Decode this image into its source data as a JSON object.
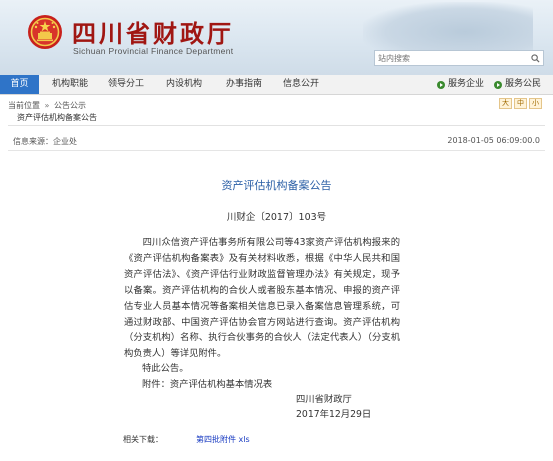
{
  "header": {
    "title": "四川省财政厅",
    "subtitle": "Sichuan Provincial Finance Department",
    "emblem_icon": "national-emblem-icon"
  },
  "search": {
    "placeholder": "站内搜索",
    "icon": "search-icon"
  },
  "nav": {
    "items": [
      {
        "label": "首页",
        "active": true
      },
      {
        "label": "机构职能",
        "active": false
      },
      {
        "label": "领导分工",
        "active": false
      },
      {
        "label": "内设机构",
        "active": false
      },
      {
        "label": "办事指南",
        "active": false
      },
      {
        "label": "信息公开",
        "active": false
      }
    ],
    "right": [
      {
        "label": "服务企业",
        "icon": "arrow-circle-icon"
      },
      {
        "label": "服务公民",
        "icon": "arrow-circle-icon"
      }
    ]
  },
  "breadcrumb": {
    "items": [
      "当前位置",
      "公告公示"
    ],
    "separator": "»",
    "current": "资产评估机构备案公告"
  },
  "font_tools": [
    "大",
    "中",
    "小"
  ],
  "meta": {
    "source": "信息来源：企业处",
    "timestamp": "2018-01-05 06:09:00.0"
  },
  "document": {
    "title": "资产评估机构备案公告",
    "number": "川财企〔2017〕103号",
    "body": "四川众信资产评估事务所有限公司等43家资产评估机构报来的《资产评估机构备案表》及有关材料收悉，根据《中华人民共和国资产评估法》、《资产评估行业财政监督管理办法》有关规定，现予以备案。资产评估机构的合伙人或者股东基本情况、申报的资产评估专业人员基本情况等备案相关信息已录入备案信息管理系统，可通过财政部、中国资产评估协会官方网站进行查询。资产评估机构（分支机构）名称、执行合伙事务的合伙人（法定代表人）（分支机构负责人）等详见附件。",
    "closing": "特此公告。",
    "attachment": "附件：资产评估机构基本情况表",
    "signer": "四川省财政厅",
    "date": "2017年12月29日"
  },
  "downloads": {
    "label": "相关下载：",
    "file": "第四批附件 xls"
  },
  "colors": {
    "brand_red": "#a01612",
    "nav_active": "#2f74c8",
    "title_blue": "#2b5fa6",
    "link_blue": "#1a3cc2"
  }
}
